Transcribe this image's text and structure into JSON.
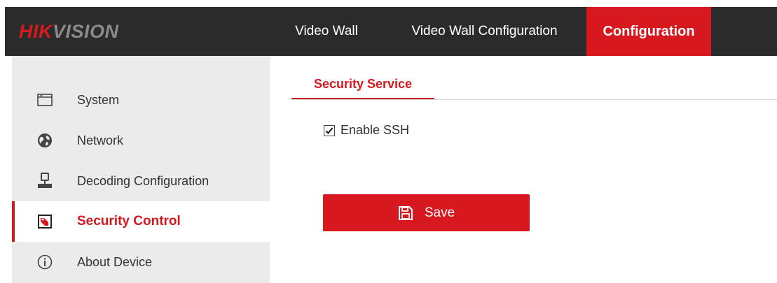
{
  "brand": {
    "part1": "HIK",
    "part2": "VISION",
    "accent_color": "#d7191f"
  },
  "topnav": {
    "items": [
      {
        "label": "Video Wall",
        "active": false
      },
      {
        "label": "Video Wall Configuration",
        "active": false
      },
      {
        "label": "Configuration",
        "active": true
      }
    ]
  },
  "sidebar": {
    "items": [
      {
        "label": "System",
        "icon": "window-icon",
        "active": false
      },
      {
        "label": "Network",
        "icon": "globe-icon",
        "active": false
      },
      {
        "label": "Decoding Configuration",
        "icon": "user-config-icon",
        "active": false
      },
      {
        "label": "Security Control",
        "icon": "security-icon",
        "active": true
      },
      {
        "label": "About Device",
        "icon": "info-icon",
        "active": false
      }
    ]
  },
  "main": {
    "tab_label": "Security Service",
    "enable_ssh": {
      "label": "Enable SSH",
      "checked": true
    },
    "save_button": {
      "label": "Save",
      "icon": "floppy-disk-icon"
    }
  }
}
